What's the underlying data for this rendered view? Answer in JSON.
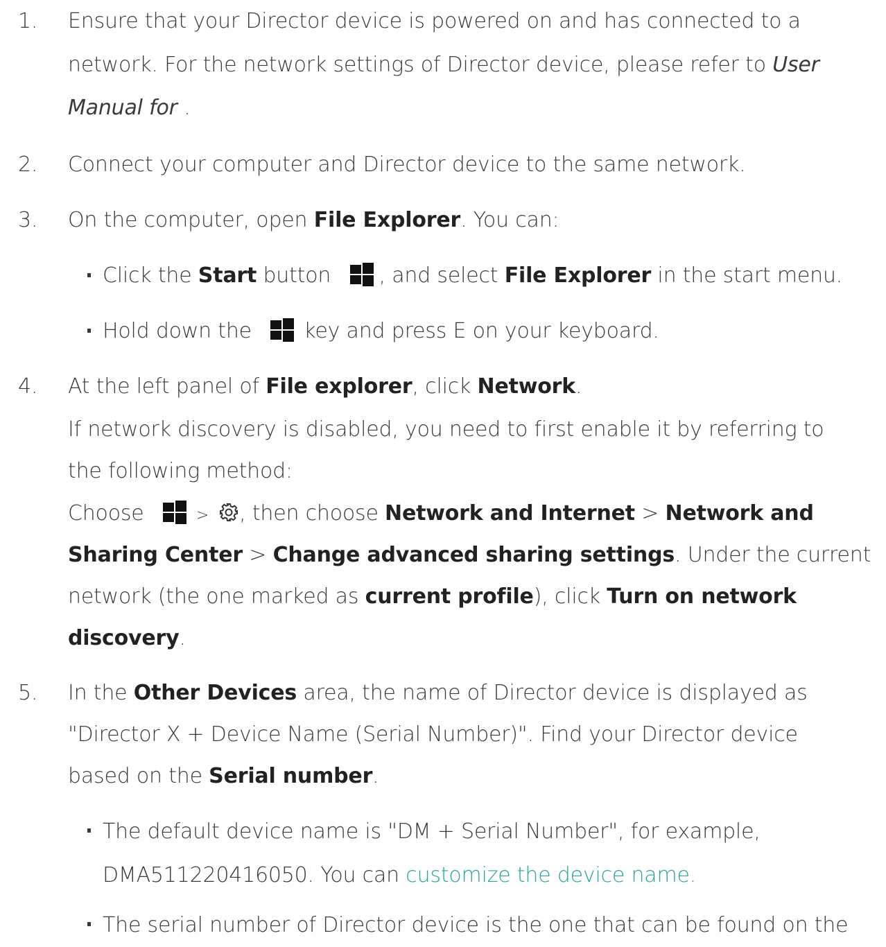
{
  "step1": {
    "num": "1.",
    "l1": "Ensure that your Director device is powered on and has connected to a",
    "l2a": "network. For the network settings of Director device, please refer to ",
    "l2b": "User",
    "l3a": "Manual for",
    "l3b": " ."
  },
  "step2": {
    "num": "2.",
    "text": "Connect your computer and Director device to the same network."
  },
  "step3": {
    "num": "3.",
    "a": "On the computer, open ",
    "b": "File Explorer",
    "c": ". You can:",
    "bullet1": {
      "a": "Click the ",
      "b": "Start",
      "c": " button",
      "d": ", and select ",
      "e": "File Explorer",
      "f": " in the start menu."
    },
    "bullet2": {
      "a": "Hold down the",
      "b": "key and press E on your keyboard."
    }
  },
  "step4": {
    "num": "4.",
    "a": "At the left panel of ",
    "b": "File explorer",
    "c": ", click ",
    "d": "Network",
    "e": ".",
    "p1": "If network discovery is disabled, you need to first enable it by referring to",
    "p2": "the following method:",
    "c1": "Choose",
    "c2": ">",
    "c3": ", then choose ",
    "c4": "Network and Internet",
    "c5": " > ",
    "c6": "Network and",
    "d1": "Sharing Center",
    "d2": " > ",
    "d3": "Change advanced sharing settings",
    "d4": ". Under the current",
    "e1": "network (the one marked as ",
    "e2": "current profile",
    "e3": "), click ",
    "e4": "Turn on network",
    "f1": "discovery",
    "f2": "."
  },
  "step5": {
    "num": "5.",
    "a": "In the ",
    "b": "Other Devices",
    "c": " area, the name of Director device is displayed as",
    "l2": "\"Director X + Device Name (Serial Number)\". Find your Director device",
    "l3a": "based on the ",
    "l3b": "Serial number",
    "l3c": ".",
    "bullet1": {
      "l1": "The default device name is \"DM + Serial Number\", for example,",
      "l2a": "DMA511220416050. You can ",
      "link": "customize the device name."
    },
    "bullet2": {
      "l1": "The serial number of Director device is the one that can be found on the"
    }
  },
  "icons": {
    "windows": "windows-logo-icon",
    "settings": "gear-icon"
  }
}
